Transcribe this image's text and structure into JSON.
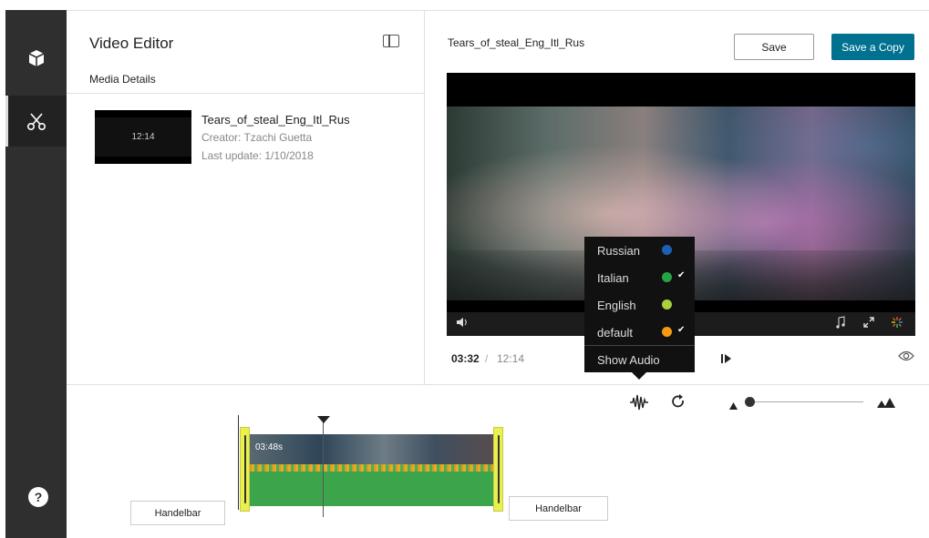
{
  "app": {
    "title": "Video Editor",
    "media_details_label": "Media Details"
  },
  "media_entry": {
    "name": "Tears_of_steal_Eng_Itl_Rus",
    "creator": "Creator: Tzachi Guetta",
    "last_update": "Last update: 1/10/2018",
    "thumb_duration": "12:14"
  },
  "player": {
    "title": "Tears_of_steal_Eng_Itl_Rus",
    "save_label": "Save",
    "save_copy_label": "Save a Copy",
    "current_time": "03:32",
    "time_separator": "/",
    "total_time": "12:14"
  },
  "audio_menu": {
    "items": [
      {
        "label": "Russian",
        "color": "#1d5fb3",
        "checked": false
      },
      {
        "label": "Italian",
        "color": "#27a345",
        "checked": true
      },
      {
        "label": "English",
        "color": "#a8d13b",
        "checked": false
      },
      {
        "label": "default",
        "color": "#f59a12",
        "checked": true
      }
    ],
    "show_audio_label": "Show Audio"
  },
  "timeline": {
    "clip_time": "03:48s",
    "left_handle_label": "Handelbar",
    "right_handle_label": "Handelbar"
  },
  "colors": {
    "sidebar": "#2f2f2f",
    "accent": "#00728f",
    "handle": "#eaf04c",
    "waveform": "#3ca54c"
  },
  "icons": {
    "sidebar_top": "cube-icon",
    "sidebar_active": "scissors-icon",
    "sidebar_bottom": "help-icon",
    "layout_toggle": "split-panel-icon",
    "volume": "volume-icon",
    "music": "music-note-icon",
    "fullscreen": "expand-icon",
    "color_wheel": "color-wheel-icon",
    "eye": "eye-icon",
    "step": "step-forward-icon",
    "waveform": "waveform-icon",
    "refresh": "refresh-icon",
    "zoom_out": "zoom-out-icon",
    "zoom_in": "zoom-in-icon"
  }
}
